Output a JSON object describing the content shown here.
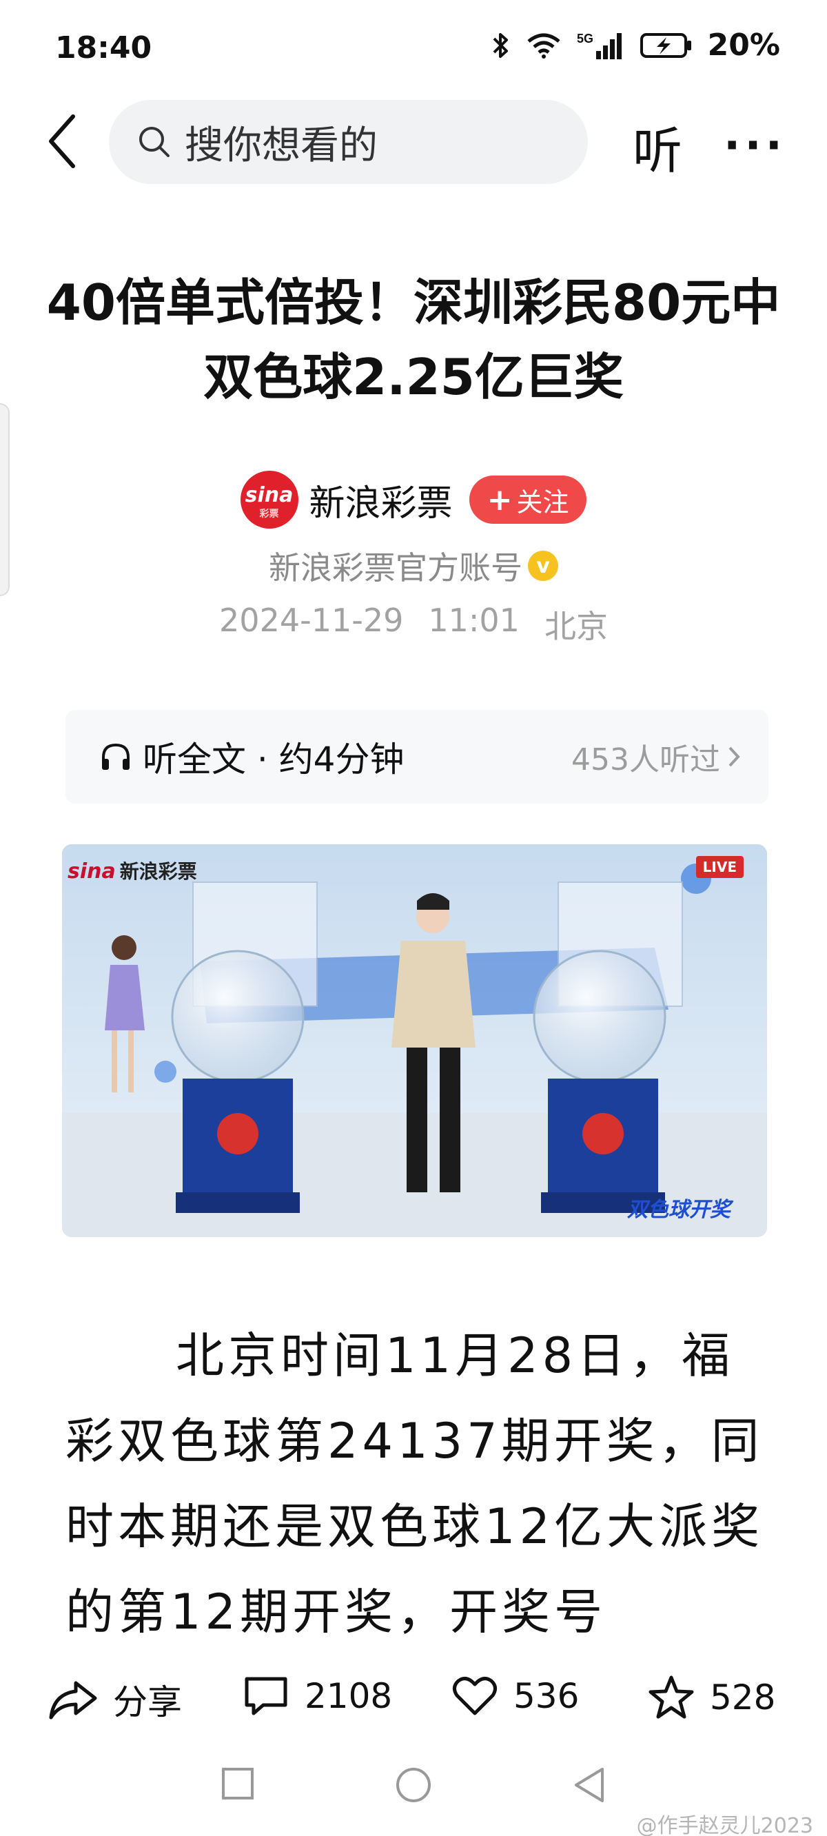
{
  "status_bar": {
    "time": "18:40",
    "battery_percent": "20%",
    "network": "5G",
    "icons": [
      "bluetooth-icon",
      "wifi-icon",
      "signal-icon",
      "battery-icon"
    ]
  },
  "top_nav": {
    "search_placeholder": "搜你想看的",
    "listen_label": "听",
    "more_label": "···"
  },
  "article": {
    "title": "40倍单式倍投！深圳彩民80元中双色球2.25亿巨奖",
    "author": {
      "name": "新浪彩票",
      "avatar_text": "sina",
      "avatar_sub": "彩票",
      "follow_label": "关注",
      "description": "新浪彩票官方账号",
      "verified_mark": "v"
    },
    "date": "2024-11-29",
    "time": "11:01",
    "location": "北京",
    "listen": {
      "label": "听全文 · 约4分钟",
      "count": "453人听过"
    },
    "image": {
      "brand": "sina",
      "brand_cn": "新浪彩票",
      "live_badge": "LIVE",
      "show_logo": "双色球开奖"
    },
    "body_text": "北京时间11月28日，福彩双色球第24137期开奖，同时本期还是双色球12亿大派奖的第12期开奖，开奖号"
  },
  "actions": {
    "share_label": "分享",
    "comments": "2108",
    "likes": "536",
    "favorites": "528"
  },
  "watermark": "@作手赵灵儿2023",
  "colors": {
    "accent_red": "#f04949",
    "brand_red": "#e0202b",
    "verified_gold": "#f5c220",
    "muted_text": "#8a8a8a"
  }
}
